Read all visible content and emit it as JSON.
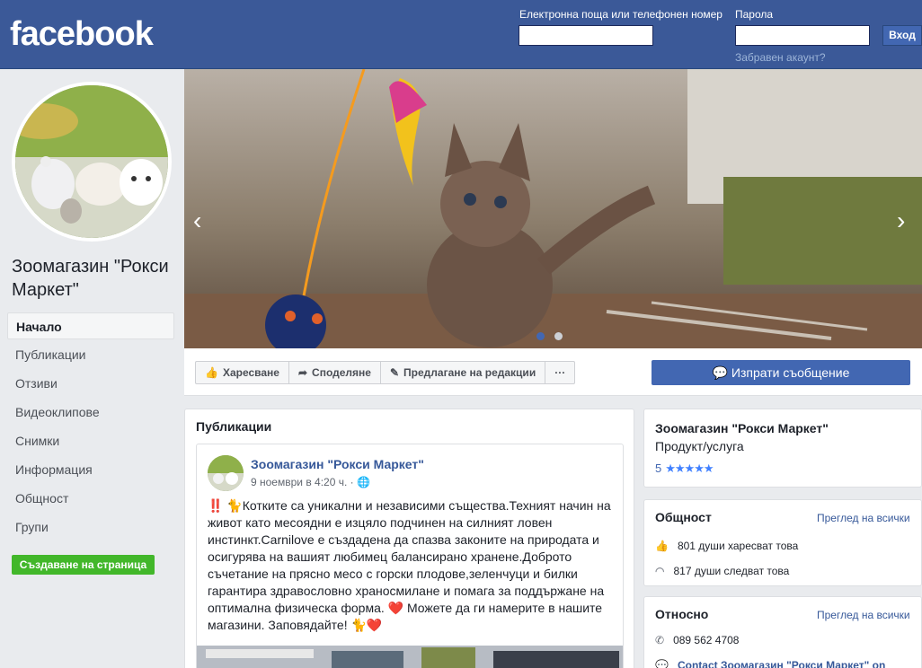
{
  "brand": {
    "logo": "facebook",
    "color": "#3b5998"
  },
  "login": {
    "email_label": "Електронна поща или телефонен номер",
    "email_value": "",
    "password_label": "Парола",
    "password_value": "",
    "login_button": "Вход",
    "forgot_link": "Забравен акаунт?"
  },
  "page": {
    "name": "Зоомагазин \"Рокси Маркет\""
  },
  "sidebar": {
    "items": [
      {
        "label": "Начало",
        "active": true
      },
      {
        "label": "Публикации"
      },
      {
        "label": "Отзиви"
      },
      {
        "label": "Видеоклипове"
      },
      {
        "label": "Снимки"
      },
      {
        "label": "Информация"
      },
      {
        "label": "Общност"
      },
      {
        "label": "Групи"
      }
    ],
    "create_page": "Създаване на страница"
  },
  "actions": {
    "like": "Харесване",
    "share": "Споделяне",
    "suggest": "Предлагане на редакции",
    "more": "···",
    "message": "Изпрати съобщение"
  },
  "feed": {
    "title": "Публикации",
    "post": {
      "author": "Зоомагазин \"Рокси Маркет\"",
      "date": "9 ноември в 4:20 ч. ·",
      "text": "‼️ 🐈Котките са уникални и независими същества.Техният начин на живот като месоядни е изцяло подчинен на силният ловен инстинкт.Carnilove е създадена да спазва законите на природата и осигурява на вашият любимец балансирано хранене.Доброто съчетание на прясно месо с горски плодове,зеленчуци и билки гарантира здравословно храносмилане и помага за поддържане на оптимална физическа форма. ❤️ Можете да ги намерите в нашите магазини. Заповядайте! 🐈❤️"
    }
  },
  "about_card": {
    "name": "Зоомагазин \"Рокси Маркет\"",
    "category": "Продукт/услуга",
    "rating": "5",
    "stars": "★★★★★"
  },
  "community": {
    "title": "Общност",
    "see_all": "Преглед на всички",
    "likes": "801 души харесват това",
    "follows": "817 души следват това"
  },
  "about": {
    "title": "Относно",
    "see_all": "Преглед на всички",
    "phone": "089 562 4708",
    "contact": "Contact Зоомагазин \"Рокси Маркет\" on"
  },
  "colors": {
    "accent": "#4267b2",
    "link": "#365899",
    "green": "#42b72a",
    "star": "#4080ff"
  }
}
